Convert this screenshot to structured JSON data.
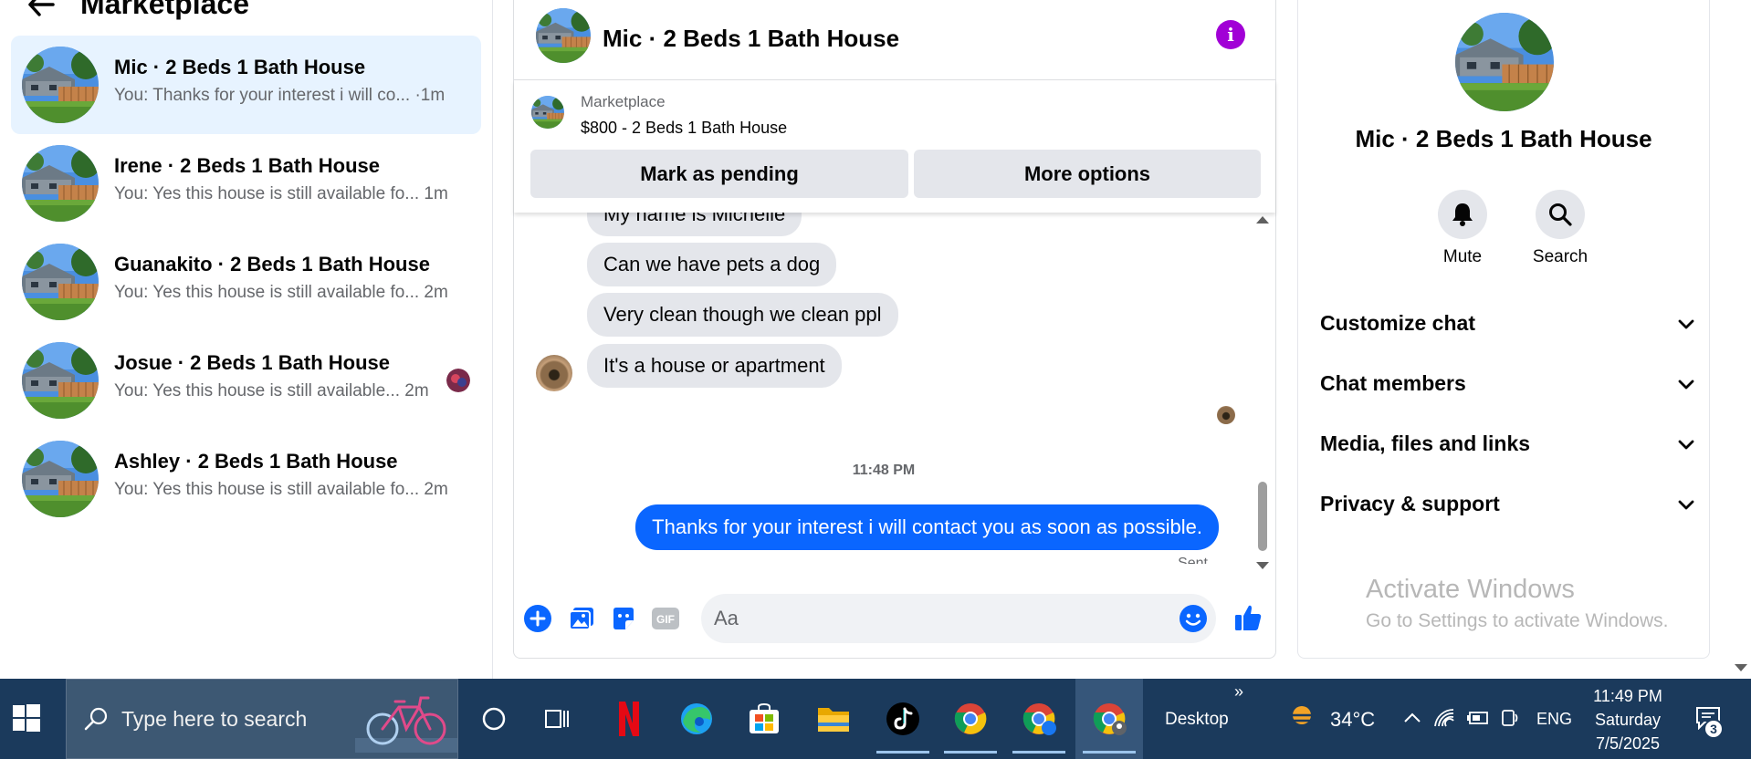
{
  "left": {
    "title": "Marketplace",
    "conversations": [
      {
        "name": "Mic · 2 Beds 1 Bath House",
        "preview": "You: Thanks for your interest i will co... ·1m",
        "active": true
      },
      {
        "name": "Irene · 2 Beds 1 Bath House",
        "preview": "You: Yes this house is still available fo...  1m"
      },
      {
        "name": "Guanakito · 2 Beds 1 Bath House",
        "preview": "You: Yes this house is still available fo...  2m"
      },
      {
        "name": "Josue · 2 Beds 1 Bath House",
        "preview": "You: Yes this house is still available...  2m"
      },
      {
        "name": "Ashley · 2 Beds 1 Bath House",
        "preview": "You: Yes this house is still available fo...  2m"
      }
    ]
  },
  "chat": {
    "title": "Mic · 2 Beds 1 Bath House",
    "marketplace_label": "Marketplace",
    "listing": "$800 - 2 Beds 1 Bath House",
    "mark_pending": "Mark as pending",
    "more_options": "More options",
    "incoming": [
      "My name is Michelle",
      "Can we have pets a dog",
      "Very clean though we clean ppl",
      "It's a house or apartment"
    ],
    "time": "11:48 PM",
    "outgoing": "Thanks for your interest i will contact you as soon as possible.",
    "sent": "Sent",
    "input_placeholder": "Aa",
    "gif_label": "GIF"
  },
  "details": {
    "title": "Mic · 2 Beds 1 Bath House",
    "mute": "Mute",
    "search": "Search",
    "rows": [
      "Customize chat",
      "Chat members",
      "Media, files and links",
      "Privacy & support"
    ]
  },
  "watermark": {
    "line1": "Activate Windows",
    "line2": "Go to Settings to activate Windows."
  },
  "taskbar": {
    "search_placeholder": "Type here to search",
    "desktop": "Desktop",
    "chevrons": "»",
    "temperature": "34°C",
    "language": "ENG",
    "time": "11:49 PM",
    "day": "Saturday",
    "date": "7/5/2025",
    "notifications": "3"
  },
  "colors": {
    "accent": "#0a66ff",
    "active_conversation": "#e7f3ff",
    "info": "#a100d6",
    "taskbar": "#1b3a5c"
  }
}
